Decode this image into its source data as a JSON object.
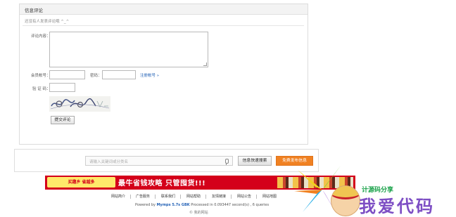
{
  "comment_form": {
    "title": "信息评论",
    "note": "还没有人发表评论哦 ^_^",
    "content_label": "评论内容：",
    "account_label": "会员帐号：",
    "password_label": "密码：",
    "register_link": "注册帐号 »",
    "captcha_label": "验 证 码：",
    "submit_label": "提交评论"
  },
  "search": {
    "placeholder": "请输入关键词或分类名",
    "search_button": "信息快速搜索",
    "post_button": "免费发布信息"
  },
  "ad": {
    "left_text": "买趣乡 省越多",
    "main_text": "最牛省钱攻略 只管囤货!!!"
  },
  "footer": {
    "links": [
      "网站简介",
      "广告服务",
      "联系我们",
      "网站帮助",
      "友情链接",
      "网站公告",
      "网站地图"
    ],
    "powered_prefix": "Powered by ",
    "powered_brand": "Mymps 5.7s GBK",
    "powered_suffix": " Processed in 0.093447 second(s) , 6 queries",
    "copyright": "© 我的网站"
  },
  "watermark": {
    "text": "我爱代码",
    "sub": "计源码分享"
  },
  "colors": {
    "accent": "#f08122",
    "link": "#1f5fb5",
    "ad_red": "#d4001a",
    "watermark": "#7d4ec4"
  }
}
